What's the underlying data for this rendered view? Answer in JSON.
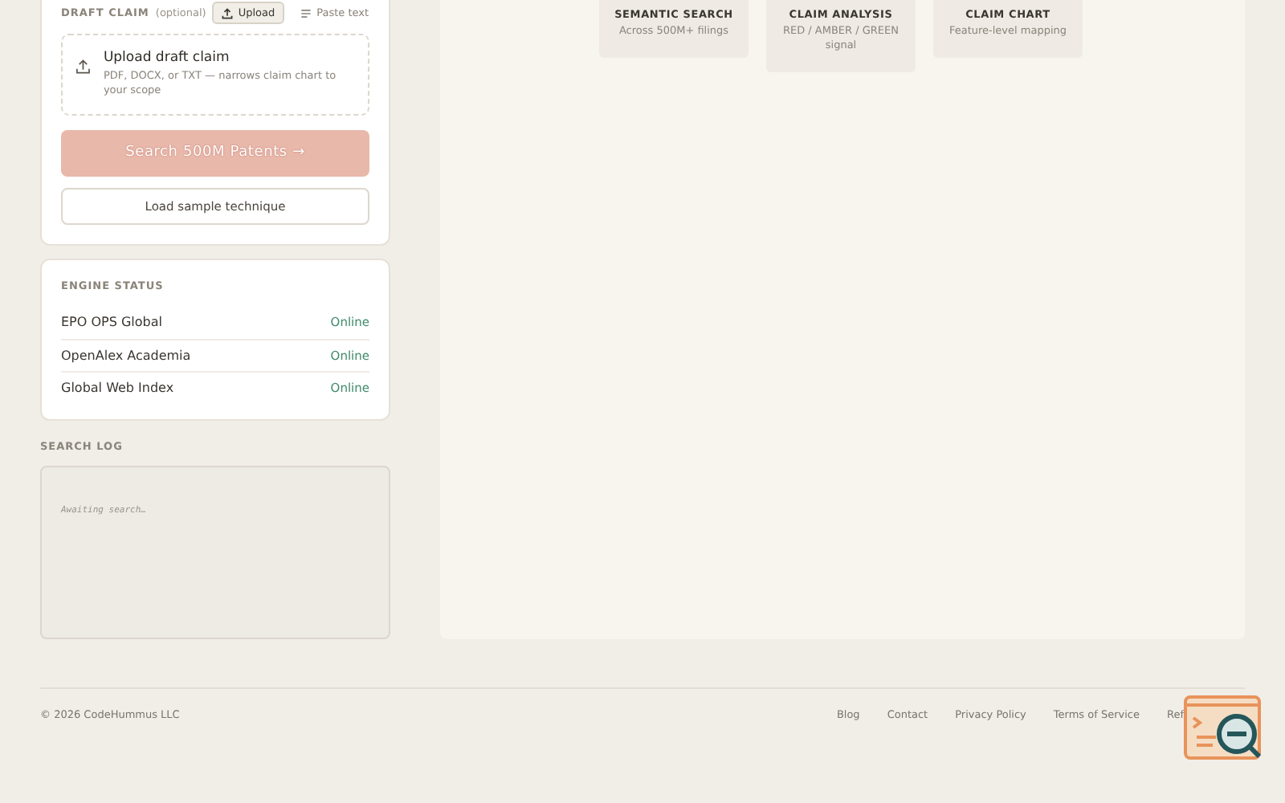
{
  "draft_claim": {
    "label": "DRAFT CLAIM",
    "hint": "(optional)",
    "modes": [
      {
        "label": "Upload",
        "kind": "upload",
        "selected": true
      },
      {
        "label": "Paste text",
        "kind": "paste",
        "selected": false
      }
    ],
    "upload": {
      "title": "Upload draft claim",
      "description": "PDF, DOCX, or TXT — narrows claim chart to your scope"
    },
    "search_button": {
      "label": "Search 500M Patents →",
      "disabled": true
    },
    "sample_button": "Load sample technique"
  },
  "engine_status": {
    "title": "ENGINE STATUS",
    "engines": [
      {
        "name": "EPO OPS Global",
        "status": "Online",
        "online": true
      },
      {
        "name": "OpenAlex Academia",
        "status": "Online",
        "online": true
      },
      {
        "name": "Global Web Index",
        "status": "Online",
        "online": true
      }
    ]
  },
  "search_log": {
    "title": "SEARCH LOG",
    "placeholder": "Awaiting search…"
  },
  "features": [
    {
      "title": "SEMANTIC SEARCH",
      "description": "Across 500M+ filings"
    },
    {
      "title": "CLAIM ANALYSIS",
      "description": "RED / AMBER / GREEN signal"
    },
    {
      "title": "CLAIM CHART",
      "description": "Feature-level mapping"
    }
  ],
  "footer": {
    "copyright": "© 2026 CodeHummus LLC",
    "links": [
      "Blog",
      "Contact",
      "Privacy Policy",
      "Terms of Service",
      "Ref"
    ]
  }
}
